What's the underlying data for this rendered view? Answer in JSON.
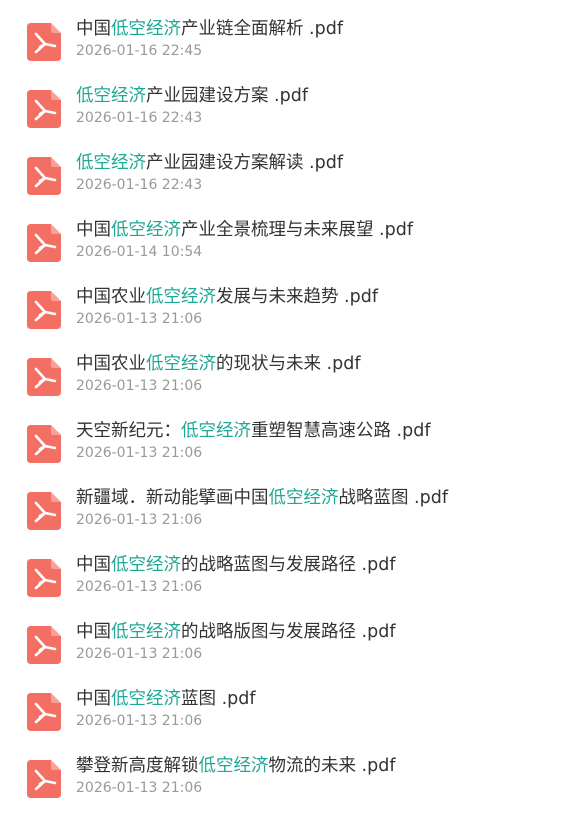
{
  "icon_name": "pdf-icon",
  "icon_color": "#f46f63",
  "highlight_color": "#20a896",
  "files": [
    {
      "pre": "中国",
      "hl": "低空经济",
      "post": "产业链全面解析 .pdf",
      "date": "2026-01-16 22:45"
    },
    {
      "pre": "",
      "hl": "低空经济",
      "post": "产业园建设方案 .pdf",
      "date": "2026-01-16 22:43"
    },
    {
      "pre": "",
      "hl": "低空经济",
      "post": "产业园建设方案解读 .pdf",
      "date": "2026-01-16 22:43"
    },
    {
      "pre": "中国",
      "hl": "低空经济",
      "post": "产业全景梳理与未来展望 .pdf",
      "date": "2026-01-14 10:54"
    },
    {
      "pre": "中国农业",
      "hl": "低空经济",
      "post": "发展与未来趋势 .pdf",
      "date": "2026-01-13 21:06"
    },
    {
      "pre": "中国农业",
      "hl": "低空经济",
      "post": "的现状与未来 .pdf",
      "date": "2026-01-13 21:06"
    },
    {
      "pre": "天空新纪元：",
      "hl": "低空经济",
      "post": "重塑智慧高速公路 .pdf",
      "date": "2026-01-13 21:06"
    },
    {
      "pre": "新疆域．新动能擘画中国",
      "hl": "低空经济",
      "post": "战略蓝图 .pdf",
      "date": "2026-01-13 21:06"
    },
    {
      "pre": "中国",
      "hl": "低空经济",
      "post": "的战略蓝图与发展路径 .pdf",
      "date": "2026-01-13 21:06"
    },
    {
      "pre": "中国",
      "hl": "低空经济",
      "post": "的战略版图与发展路径 .pdf",
      "date": "2026-01-13 21:06"
    },
    {
      "pre": "中国",
      "hl": "低空经济",
      "post": "蓝图 .pdf",
      "date": "2026-01-13 21:06"
    },
    {
      "pre": "攀登新高度解锁",
      "hl": "低空经济",
      "post": "物流的未来 .pdf",
      "date": "2026-01-13 21:06"
    }
  ]
}
